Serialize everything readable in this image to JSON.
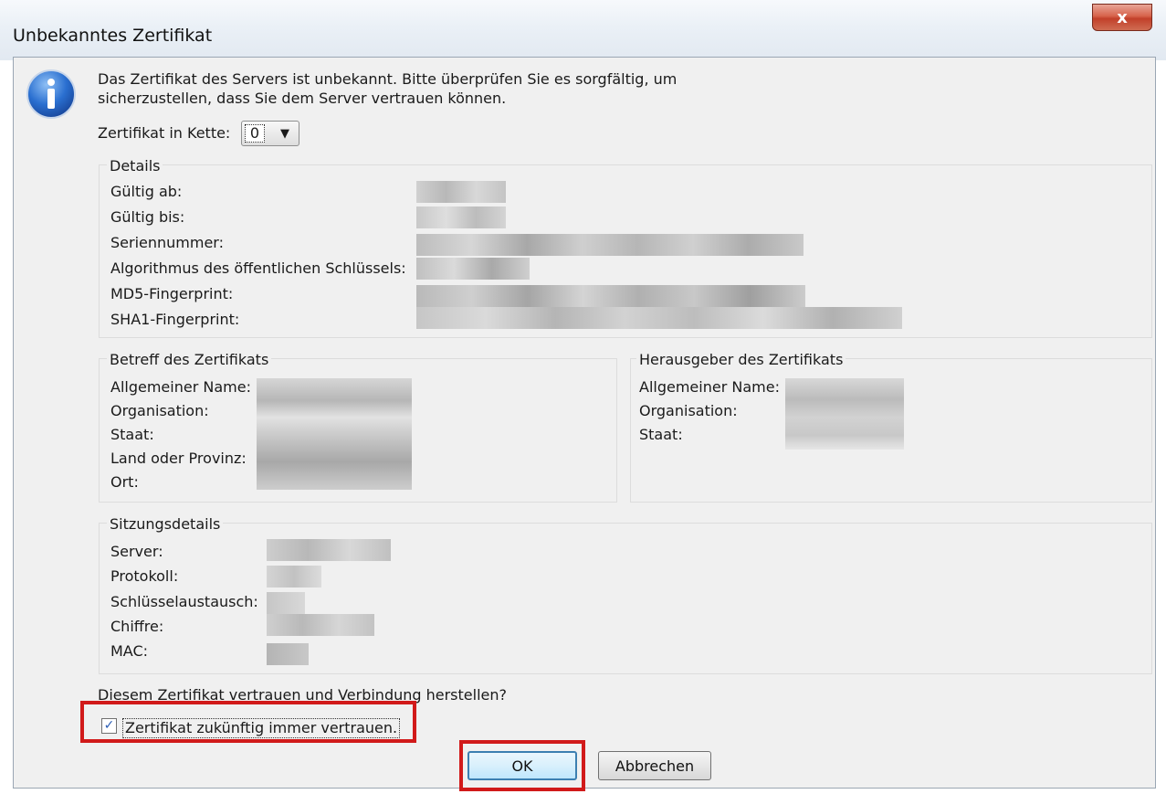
{
  "window": {
    "title": "Unbekanntes Zertifikat",
    "close_symbol": "x"
  },
  "message": {
    "line1": "Das Zertifikat des Servers ist unbekannt. Bitte überprüfen Sie es sorgfältig, um",
    "line2": "sicherzustellen, dass Sie dem Server vertrauen können."
  },
  "chain": {
    "label": "Zertifikat in Kette:",
    "selected": "0"
  },
  "details": {
    "title": "Details",
    "labels": {
      "valid_from": "Gültig ab:",
      "valid_to": "Gültig bis:",
      "serial": "Seriennummer:",
      "algorithm": "Algorithmus des öffentlichen Schlüssels:",
      "md5": "MD5-Fingerprint:",
      "sha1": "SHA1-Fingerprint:"
    }
  },
  "subject": {
    "title": "Betreff des Zertifikats",
    "labels": {
      "common_name": "Allgemeiner Name:",
      "organization": "Organisation:",
      "country": "Staat:",
      "state": "Land oder Provinz:",
      "locality": "Ort:"
    }
  },
  "issuer": {
    "title": "Herausgeber des Zertifikats",
    "labels": {
      "common_name": "Allgemeiner Name:",
      "organization": "Organisation:",
      "country": "Staat:"
    }
  },
  "session": {
    "title": "Sitzungsdetails",
    "labels": {
      "server": "Server:",
      "protocol": "Protokoll:",
      "key_exchange": "Schlüsselaustausch:",
      "cipher": "Chiffre:",
      "mac": "MAC:"
    }
  },
  "trust": {
    "question": "Diesem Zertifikat vertrauen und Verbindung herstellen?",
    "checkbox_label": "Zertifikat zukünftig immer vertrauen.",
    "checked": true,
    "check_mark": "✓"
  },
  "buttons": {
    "ok": "OK",
    "cancel": "Abbrechen"
  },
  "colors": {
    "highlight": "#d11a1a",
    "blur_dark": "#9a9a9a",
    "blur_light": "#dcdcdc"
  }
}
